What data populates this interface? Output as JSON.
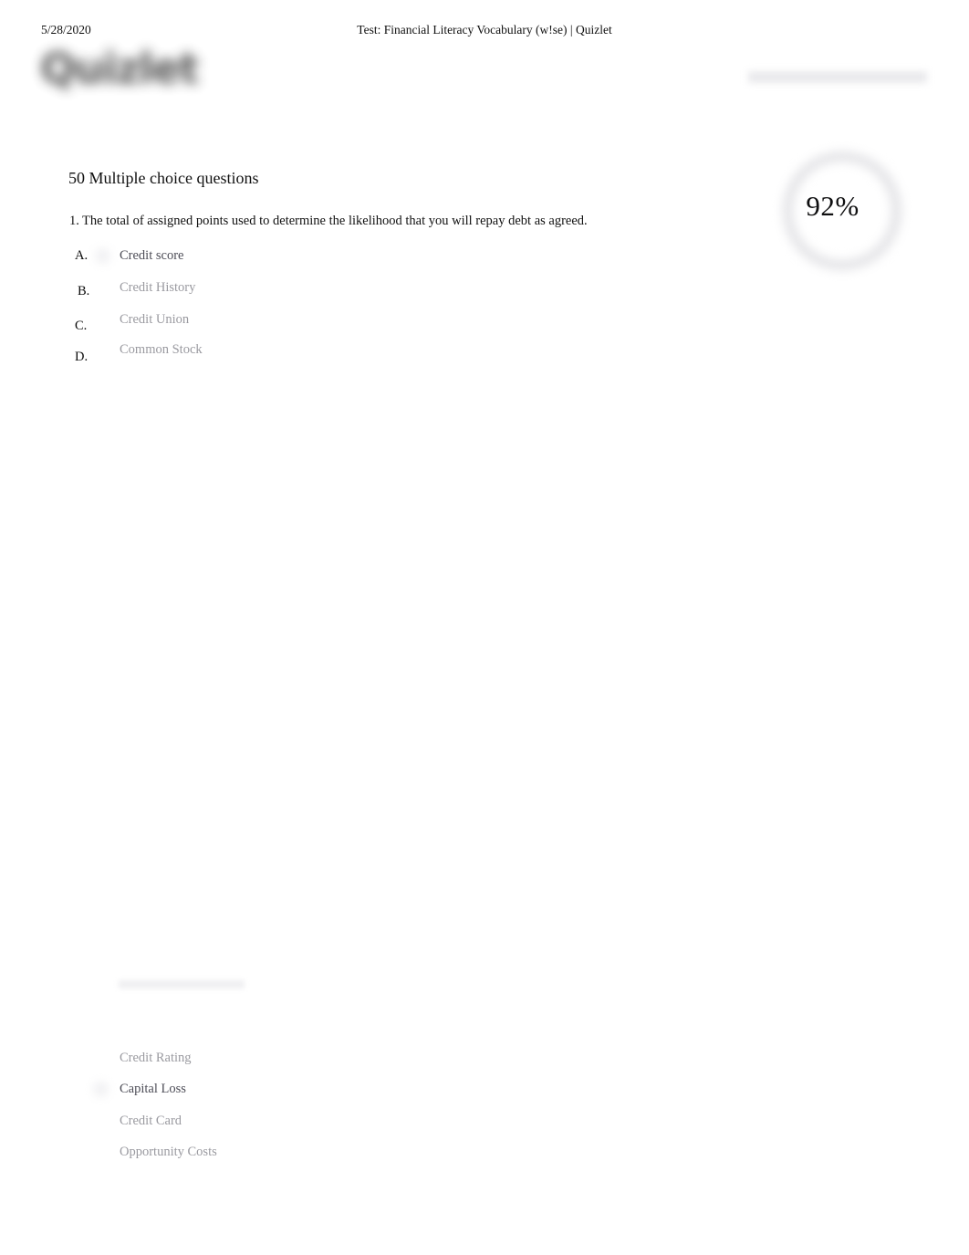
{
  "print_header": {
    "date": "5/28/2020",
    "title": "Test: Financial Literacy Vocabulary (w!se) | Quizlet"
  },
  "brand": {
    "logo_text": "Quizlet"
  },
  "score": {
    "value": "92%",
    "ring_color": "#e4e4e7"
  },
  "main": {
    "heading": "50 Multiple choice questions"
  },
  "questions": [
    {
      "number": "1.",
      "text": "The total of assigned points used to determine the likelihood that you will repay debt as agreed.",
      "choices": [
        {
          "letter": "A.",
          "label": "Credit score",
          "selected": true
        },
        {
          "letter": "B.",
          "label": "Credit History",
          "selected": false
        },
        {
          "letter": "C.",
          "label": "Credit Union",
          "selected": false
        },
        {
          "letter": "D.",
          "label": "Common Stock",
          "selected": false
        }
      ]
    },
    {
      "number": "",
      "text": "",
      "choices": [
        {
          "letter": "",
          "label": "Credit Rating",
          "selected": false
        },
        {
          "letter": "",
          "label": "Capital Loss",
          "selected": true
        },
        {
          "letter": "",
          "label": "Credit Card",
          "selected": false
        },
        {
          "letter": "",
          "label": "Opportunity Costs",
          "selected": false
        }
      ]
    }
  ]
}
